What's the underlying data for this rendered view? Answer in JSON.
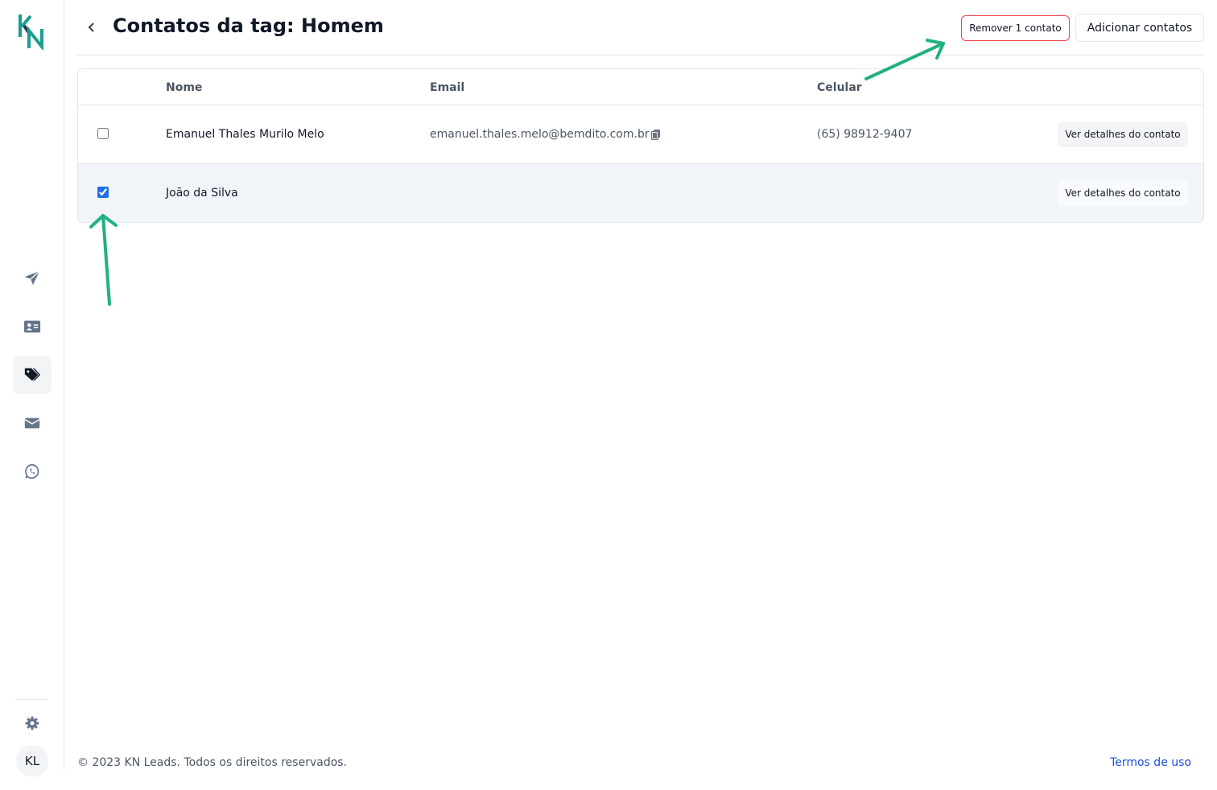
{
  "brand": {
    "logo_text": "KN",
    "primary_color": "#1a9e8f",
    "dark_color": "#1f3b4d"
  },
  "sidebar": {
    "items": [
      {
        "icon": "paper-plane-icon",
        "active": false
      },
      {
        "icon": "contact-card-icon",
        "active": false
      },
      {
        "icon": "tags-icon",
        "active": true
      },
      {
        "icon": "envelope-icon",
        "active": false
      },
      {
        "icon": "whatsapp-icon",
        "active": false
      }
    ],
    "settings_icon": "gear-icon",
    "avatar_initials": "KL"
  },
  "header": {
    "title": "Contatos da tag: Homem",
    "remove_label": "Remover 1 contato",
    "add_label": "Adicionar contatos"
  },
  "table": {
    "columns": [
      "Nome",
      "Email",
      "Celular"
    ],
    "rows": [
      {
        "checked": false,
        "name": "Emanuel Thales Murilo Melo",
        "email": "emanuel.thales.melo@bemdito.com.br",
        "phone": "(65) 98912-9407",
        "action": "Ver detalhes do contato"
      },
      {
        "checked": true,
        "name": "João da Silva",
        "email": "",
        "phone": "",
        "action": "Ver detalhes do contato"
      }
    ]
  },
  "annotation_color": "#22b083",
  "footer": {
    "copyright": "© 2023 KN Leads. Todos os direitos reservados.",
    "terms_link": "Termos de uso"
  }
}
